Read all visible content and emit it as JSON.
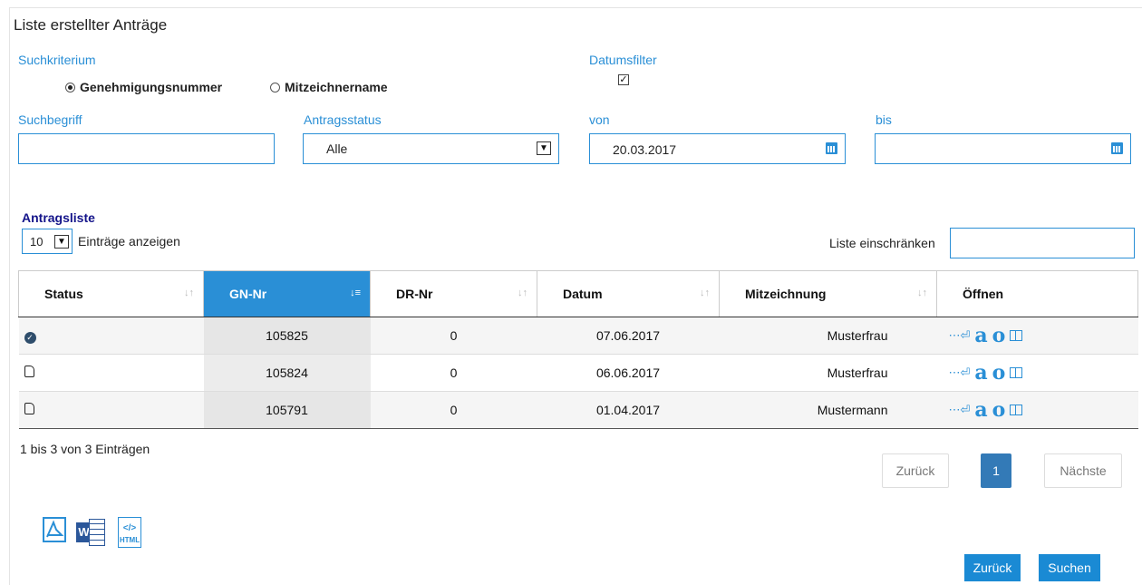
{
  "page": {
    "title": "Liste erstellter Anträge"
  },
  "search": {
    "criterion_label": "Suchkriterium",
    "option_1": "Genehmigungsnummer",
    "option_2": "Mitzeichnername",
    "date_filter_label": "Datumsfilter",
    "date_filter_checked": true,
    "term_label": "Suchbegriff",
    "term_value": "",
    "status_label": "Antragsstatus",
    "status_value": "Alle",
    "from_label": "von",
    "from_value": "20.03.2017",
    "to_label": "bis",
    "to_value": ""
  },
  "list": {
    "title": "Antragsliste",
    "page_size": "10",
    "entries_label": "Einträge anzeigen",
    "filter_label": "Liste einschränken",
    "filter_value": "",
    "columns": [
      "Status",
      "GN-Nr",
      "DR-Nr",
      "Datum",
      "Mitzeichnung",
      "Öffnen"
    ],
    "rows": [
      {
        "status": "approved",
        "gn": "105825",
        "dr": "0",
        "date": "07.06.2017",
        "signer": "Musterfrau"
      },
      {
        "status": "draft",
        "gn": "105824",
        "dr": "0",
        "date": "06.06.2017",
        "signer": "Musterfrau"
      },
      {
        "status": "draft",
        "gn": "105791",
        "dr": "0",
        "date": "01.04.2017",
        "signer": "Mustermann"
      }
    ],
    "info": "1 bis 3 von 3 Einträgen"
  },
  "pagination": {
    "prev": "Zurück",
    "current": "1",
    "next": "Nächste"
  },
  "buttons": {
    "back": "Zurück",
    "search": "Suchen"
  },
  "export": {
    "html_label": "HTML"
  },
  "colors": {
    "accent": "#2a8fd6",
    "button": "#1a8ad4",
    "status_ok": "#2e4d6b"
  }
}
